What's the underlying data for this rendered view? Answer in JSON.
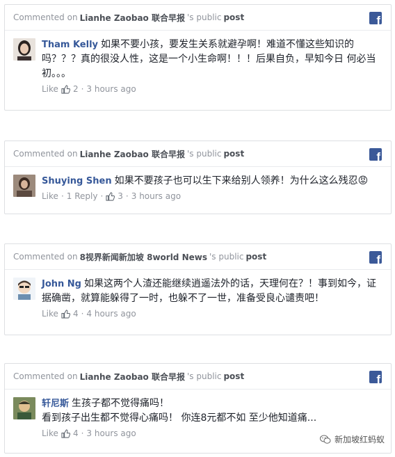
{
  "comments": [
    {
      "commented_on": "Commented on",
      "page": "Lianhe Zaobao 联合早报",
      "suffix": "'s public",
      "post_word": "post",
      "author": "Tham Kelly",
      "text": "如果不要小孩，要发生关系就避孕啊！难道不懂这些知识的吗？？？真的很没人性，这是一个小生命啊！！！后果自负，早知今日 何必当初。。。",
      "like_label": "Like",
      "reply_label": "",
      "likes": "2",
      "time": "3 hours ago"
    },
    {
      "commented_on": "Commented on",
      "page": "Lianhe Zaobao 联合早报",
      "suffix": "'s public",
      "post_word": "post",
      "author": "Shuying Shen",
      "text": "如果不要孩子也可以生下来给别人领养！为什么这么残忍😡",
      "like_label": "Like",
      "reply_label": "1 Reply",
      "likes": "3",
      "time": "3 hours ago"
    },
    {
      "commented_on": "Commented on",
      "page": "8视界新闻新加坡 8world News",
      "suffix": "'s public",
      "post_word": "post",
      "author": "John Ng",
      "text": "如果这两个人渣还能继续逍遥法外的话，天理何在？！事到如今，证据确凿，就算能躲得了一时，也躲不了一世，准备受良心谴责吧！",
      "like_label": "Like",
      "reply_label": "",
      "likes": "4",
      "time": "4 hours ago"
    },
    {
      "commented_on": "Commented on",
      "page": "Lianhe Zaobao 联合早报",
      "suffix": "'s public",
      "post_word": "post",
      "author": "轩尼斯",
      "text": "生孩子都不觉得痛吗！",
      "text2": "看到孩子出生都不觉得心痛吗！ 你连8元都不如 至少他知道痛...",
      "like_label": "Like",
      "reply_label": "",
      "likes": "4",
      "time": "3 hours ago"
    }
  ],
  "watermark": {
    "text": "新加坡红蚂蚁",
    "icon": "wechat-icon"
  },
  "colors": {
    "facebook_blue": "#3b5998",
    "link_blue": "#365899",
    "meta_gray": "#90949c",
    "border": "#dddfe2"
  }
}
